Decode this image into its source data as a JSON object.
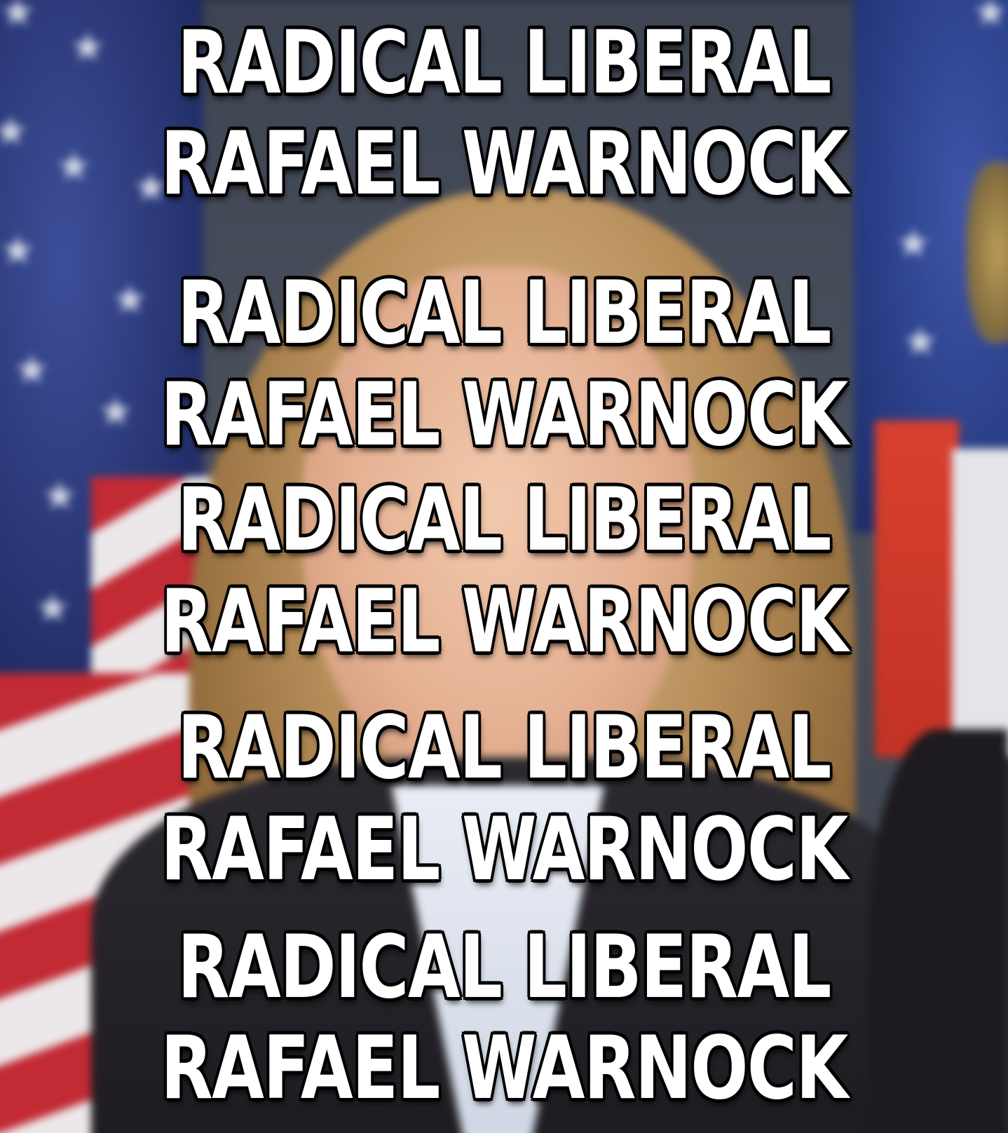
{
  "meme": {
    "lines": [
      "RADICAL LIBERAL",
      "RAFAEL WARNOCK",
      "RADICAL LIBERAL",
      "RAFAEL WARNOCK",
      "RADICAL LIBERAL",
      "RAFAEL WARNOCK",
      "RADICAL LIBERAL",
      "RAFAEL WARNOCK",
      "RADICAL LIBERAL",
      "RAFAEL WARNOCK"
    ]
  },
  "colors": {
    "text": "#ffffff",
    "text_outline": "#000000",
    "flag_blue": "#24306b",
    "flag_red": "#c22a34"
  }
}
